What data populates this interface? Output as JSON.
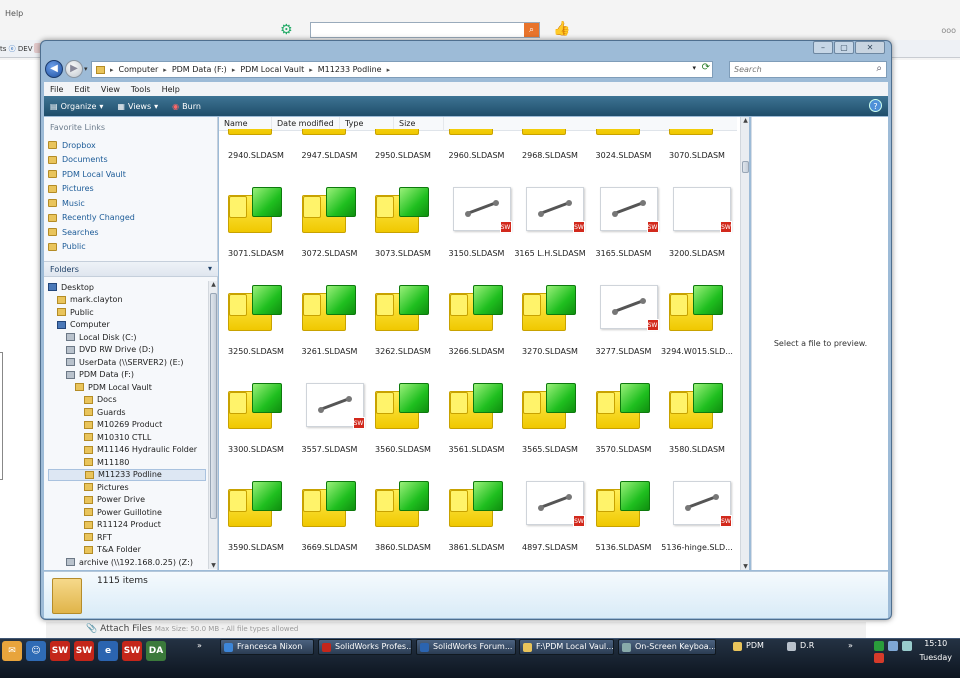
{
  "background": {
    "help_menu": "Help",
    "left_fav_text": "ts",
    "left_fav_label": "DEV",
    "right_text": "ooo",
    "attach": {
      "label": "Attach Files",
      "note": "Max Size: 50.0 MB - All file types allowed"
    }
  },
  "window": {
    "caption_buttons": {
      "minimize": "–",
      "restore": "▢",
      "close": "✕"
    },
    "address": {
      "crumbs": [
        "Computer",
        "PDM Data (F:)",
        "PDM Local Vault",
        "M11233 Podline"
      ]
    },
    "search_placeholder": "Search",
    "menu": [
      "File",
      "Edit",
      "View",
      "Tools",
      "Help"
    ],
    "toolbar": {
      "organize": "Organize",
      "views": "Views",
      "burn": "Burn",
      "help": "?"
    },
    "nav": {
      "favorites_title": "Favorite Links",
      "favorites": [
        "Dropbox",
        "Documents",
        "PDM Local Vault",
        "Pictures",
        "Music",
        "Recently Changed",
        "Searches",
        "Public"
      ],
      "folders_title": "Folders",
      "tree": [
        {
          "label": "Desktop",
          "indent": 0,
          "kind": "blue"
        },
        {
          "label": "mark.clayton",
          "indent": 1,
          "kind": "folder"
        },
        {
          "label": "Public",
          "indent": 1,
          "kind": "folder"
        },
        {
          "label": "Computer",
          "indent": 1,
          "kind": "blue"
        },
        {
          "label": "Local Disk (C:)",
          "indent": 2,
          "kind": "drive"
        },
        {
          "label": "DVD RW Drive (D:)",
          "indent": 2,
          "kind": "drive"
        },
        {
          "label": "UserData (\\\\SERVER2) (E:)",
          "indent": 2,
          "kind": "drive"
        },
        {
          "label": "PDM Data (F:)",
          "indent": 2,
          "kind": "drive"
        },
        {
          "label": "PDM Local Vault",
          "indent": 3,
          "kind": "folder"
        },
        {
          "label": "Docs",
          "indent": 4,
          "kind": "folder"
        },
        {
          "label": "Guards",
          "indent": 4,
          "kind": "folder"
        },
        {
          "label": "M10269 Product",
          "indent": 4,
          "kind": "folder"
        },
        {
          "label": "M10310 CTLL",
          "indent": 4,
          "kind": "folder"
        },
        {
          "label": "M11146 Hydraulic Folder",
          "indent": 4,
          "kind": "folder"
        },
        {
          "label": "M11180",
          "indent": 4,
          "kind": "folder"
        },
        {
          "label": "M11233 Podline",
          "indent": 4,
          "kind": "folder",
          "selected": true
        },
        {
          "label": "Pictures",
          "indent": 4,
          "kind": "folder"
        },
        {
          "label": "Power Drive",
          "indent": 4,
          "kind": "folder"
        },
        {
          "label": "Power Guillotine",
          "indent": 4,
          "kind": "folder"
        },
        {
          "label": "R11124 Product",
          "indent": 4,
          "kind": "folder"
        },
        {
          "label": "RFT",
          "indent": 4,
          "kind": "folder"
        },
        {
          "label": "T&A Folder",
          "indent": 4,
          "kind": "folder"
        },
        {
          "label": "archive (\\\\192.168.0.25) (Z:)",
          "indent": 2,
          "kind": "drive"
        }
      ]
    },
    "columns": [
      "Name",
      "Date modified",
      "Type",
      "Size"
    ],
    "files": [
      {
        "name": "2940.SLDASM",
        "thumb": "asm"
      },
      {
        "name": "2947.SLDASM",
        "thumb": "asm"
      },
      {
        "name": "2950.SLDASM",
        "thumb": "asm"
      },
      {
        "name": "2960.SLDASM",
        "thumb": "asm"
      },
      {
        "name": "2968.SLDASM",
        "thumb": "asm"
      },
      {
        "name": "3024.SLDASM",
        "thumb": "asm"
      },
      {
        "name": "3070.SLDASM",
        "thumb": "asm"
      },
      {
        "name": "3071.SLDASM",
        "thumb": "asm"
      },
      {
        "name": "3072.SLDASM",
        "thumb": "asm"
      },
      {
        "name": "3073.SLDASM",
        "thumb": "asm"
      },
      {
        "name": "3150.SLDASM",
        "thumb": "img"
      },
      {
        "name": "3165 L.H.SLDASM",
        "thumb": "img"
      },
      {
        "name": "3165.SLDASM",
        "thumb": "img"
      },
      {
        "name": "3200.SLDASM",
        "thumb": "blank"
      },
      {
        "name": "3250.SLDASM",
        "thumb": "asm"
      },
      {
        "name": "3261.SLDASM",
        "thumb": "asm"
      },
      {
        "name": "3262.SLDASM",
        "thumb": "asm"
      },
      {
        "name": "3266.SLDASM",
        "thumb": "asm"
      },
      {
        "name": "3270.SLDASM",
        "thumb": "asm"
      },
      {
        "name": "3277.SLDASM",
        "thumb": "img"
      },
      {
        "name": "3294.W015.SLD...",
        "thumb": "asm"
      },
      {
        "name": "3300.SLDASM",
        "thumb": "asm"
      },
      {
        "name": "3557.SLDASM",
        "thumb": "img"
      },
      {
        "name": "3560.SLDASM",
        "thumb": "asm"
      },
      {
        "name": "3561.SLDASM",
        "thumb": "asm"
      },
      {
        "name": "3565.SLDASM",
        "thumb": "asm"
      },
      {
        "name": "3570.SLDASM",
        "thumb": "asm"
      },
      {
        "name": "3580.SLDASM",
        "thumb": "asm"
      },
      {
        "name": "3590.SLDASM",
        "thumb": "asm"
      },
      {
        "name": "3669.SLDASM",
        "thumb": "asm"
      },
      {
        "name": "3860.SLDASM",
        "thumb": "asm"
      },
      {
        "name": "3861.SLDASM",
        "thumb": "asm"
      },
      {
        "name": "4897.SLDASM",
        "thumb": "img"
      },
      {
        "name": "5136.SLDASM",
        "thumb": "asm"
      },
      {
        "name": "5136-hinge.SLD...",
        "thumb": "img"
      }
    ],
    "preview_text": "Select a file to preview.",
    "details": {
      "count": "1115 items"
    }
  },
  "taskbar": {
    "buttons": [
      "Francesca Nixon",
      "SolidWorks Profes...",
      "SolidWorks Forum...",
      "F:\\PDM Local Vaul...",
      "On-Screen Keyboa...",
      "PDM",
      "D.R"
    ],
    "chevron": "»",
    "time": "15:10",
    "day": "Tuesday"
  }
}
